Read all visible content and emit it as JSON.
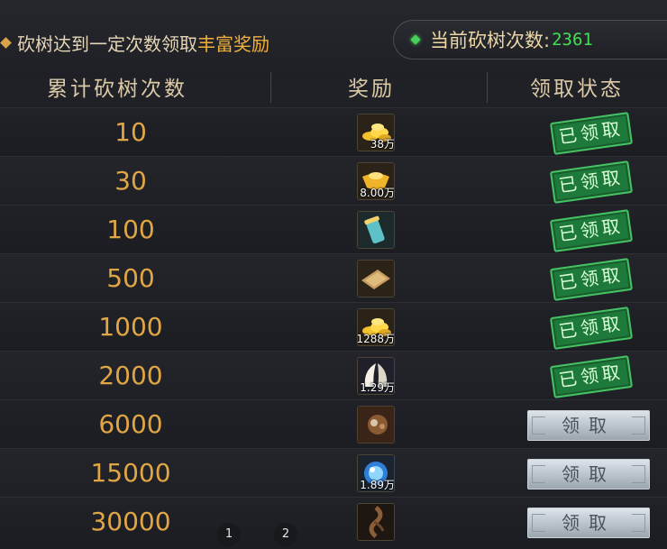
{
  "header": {
    "hint_prefix": "砍树达到一定次数领取",
    "hint_highlight": "丰富奖励",
    "count_label": "当前砍树次数:",
    "count_value": "2361"
  },
  "columns": {
    "count": "累计砍树次数",
    "reward": "奖励",
    "status": "领取状态"
  },
  "rows": [
    {
      "count": "10",
      "icon": "gold-coins-icon",
      "qty": "38万",
      "status": "claimed"
    },
    {
      "count": "30",
      "icon": "gold-ingot-icon",
      "qty": "8.00万",
      "status": "claimed"
    },
    {
      "count": "100",
      "icon": "scroll-icon",
      "qty": "",
      "status": "claimed"
    },
    {
      "count": "500",
      "icon": "book-icon",
      "qty": "",
      "status": "claimed"
    },
    {
      "count": "1000",
      "icon": "gold-coins-icon",
      "qty": "1288万",
      "status": "claimed"
    },
    {
      "count": "2000",
      "icon": "feather-icon",
      "qty": "1.29万",
      "status": "claimed"
    },
    {
      "count": "6000",
      "icon": "pet-portrait-icon",
      "qty": "",
      "status": "claim"
    },
    {
      "count": "15000",
      "icon": "blue-orb-icon",
      "qty": "1.89万",
      "status": "claim"
    },
    {
      "count": "30000",
      "icon": "dragon-icon",
      "qty": "",
      "status": "claim"
    }
  ],
  "labels": {
    "claimed": "已领取",
    "claim": "领取"
  },
  "pager": [
    "1",
    "2"
  ],
  "colors": {
    "accent": "#e0a544",
    "count_value": "#3fe054",
    "stamp": "#1e7a3a"
  }
}
